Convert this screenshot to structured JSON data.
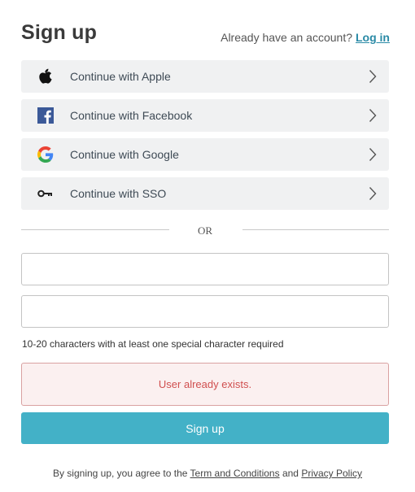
{
  "header": {
    "title": "Sign up",
    "account_prompt": "Already have an account?",
    "login_link": "Log in"
  },
  "providers": [
    {
      "label": "Continue with Apple",
      "icon": "apple-icon"
    },
    {
      "label": "Continue with Facebook",
      "icon": "facebook-icon"
    },
    {
      "label": "Continue with Google",
      "icon": "google-icon"
    },
    {
      "label": "Continue with SSO",
      "icon": "key-icon"
    }
  ],
  "divider": {
    "text": "OR"
  },
  "form": {
    "email_value": "",
    "email_placeholder": "",
    "password_value": "",
    "password_hint": "10-20 characters with at least one special character required",
    "error_message": "User already exists.",
    "submit_label": "Sign up"
  },
  "footer": {
    "prefix": "By signing up, you agree to the",
    "terms_link": "Term and Conditions",
    "and_text": "and",
    "privacy_link": "Privacy Policy"
  },
  "colors": {
    "accent": "#43b1c7",
    "link": "#2a8aa6",
    "error_text": "#d04f4f",
    "error_bg": "#fbf0f0",
    "provider_bg": "#f0f1f2"
  }
}
